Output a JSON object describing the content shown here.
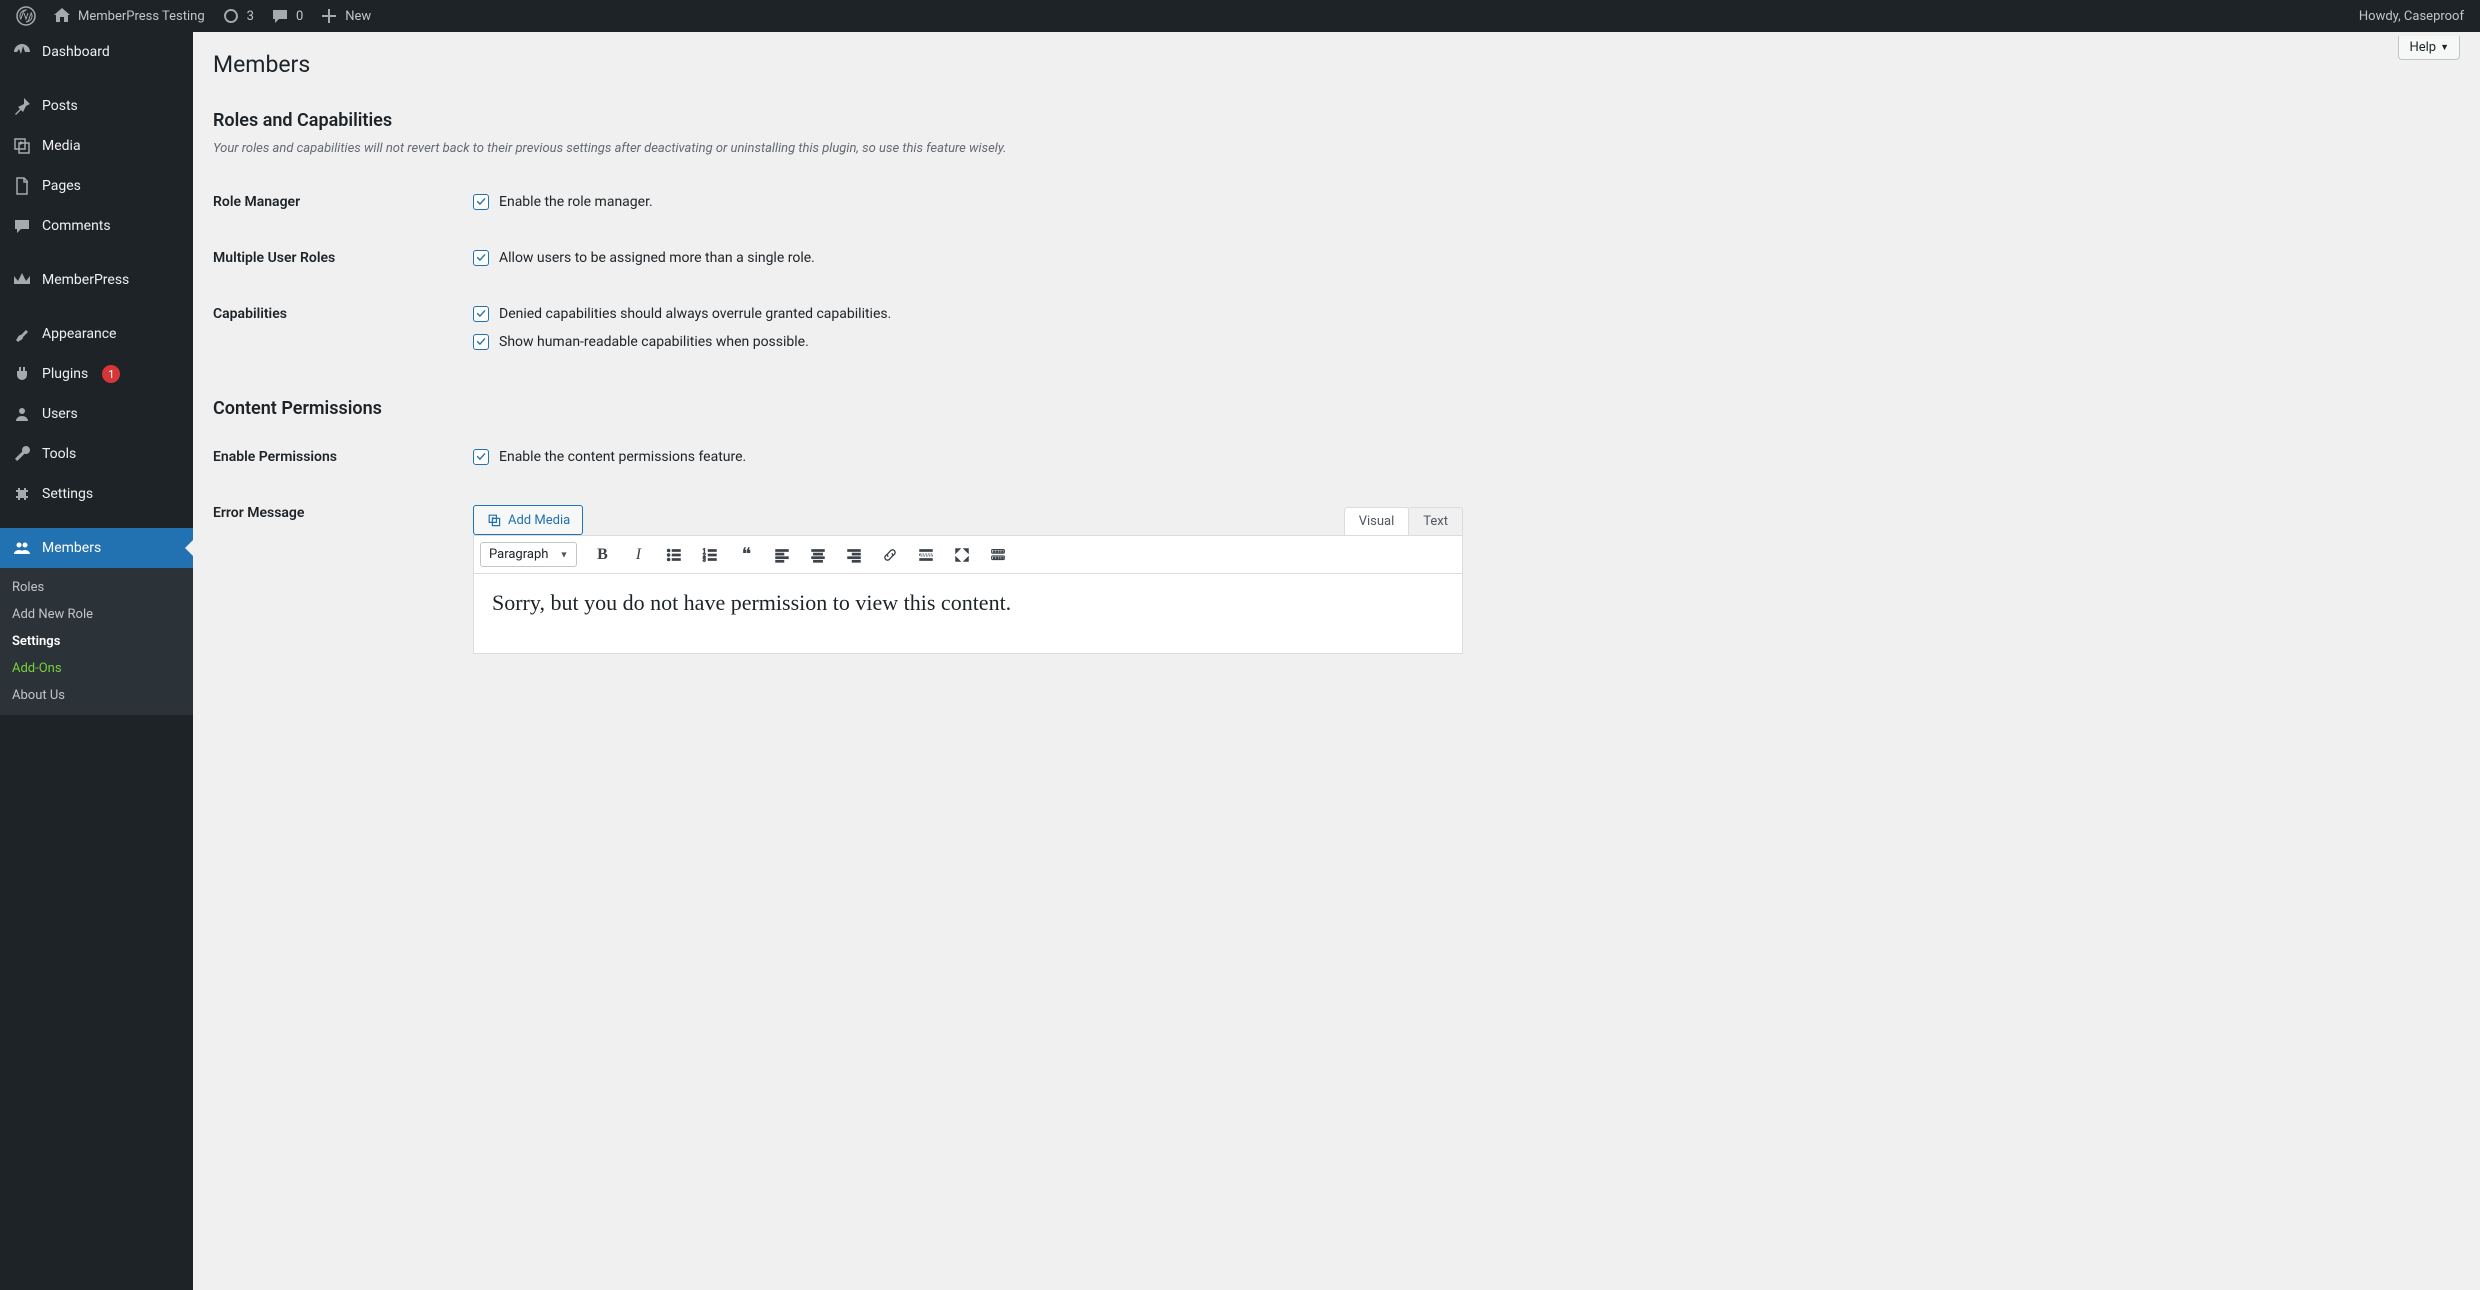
{
  "adminbar": {
    "site_name": "MemberPress Testing",
    "updates": "3",
    "comments": "0",
    "new": "New",
    "howdy": "Howdy, Caseproof"
  },
  "sidebar": {
    "items": [
      {
        "label": "Dashboard",
        "icon": "dashboard"
      },
      {
        "label": "Posts",
        "icon": "pin"
      },
      {
        "label": "Media",
        "icon": "media"
      },
      {
        "label": "Pages",
        "icon": "page"
      },
      {
        "label": "Comments",
        "icon": "comment"
      },
      {
        "label": "MemberPress",
        "icon": "memberpress"
      },
      {
        "label": "Appearance",
        "icon": "brush"
      },
      {
        "label": "Plugins",
        "icon": "plug",
        "badge": "1"
      },
      {
        "label": "Users",
        "icon": "user"
      },
      {
        "label": "Tools",
        "icon": "wrench"
      },
      {
        "label": "Settings",
        "icon": "settings"
      },
      {
        "label": "Members",
        "icon": "members",
        "current": true
      }
    ],
    "submenu": [
      {
        "label": "Roles"
      },
      {
        "label": "Add New Role"
      },
      {
        "label": "Settings",
        "current": true
      },
      {
        "label": "Add-Ons",
        "addons": true
      },
      {
        "label": "About Us"
      }
    ]
  },
  "content": {
    "help_label": "Help",
    "page_title": "Members",
    "section1": {
      "heading": "Roles and Capabilities",
      "description": "Your roles and capabilities will not revert back to their previous settings after deactivating or uninstalling this plugin, so use this feature wisely.",
      "rows": {
        "role_manager": {
          "th": "Role Manager",
          "cb_label": "Enable the role manager."
        },
        "multiple_roles": {
          "th": "Multiple User Roles",
          "cb_label": "Allow users to be assigned more than a single role."
        },
        "capabilities": {
          "th": "Capabilities",
          "cb1_label": "Denied capabilities should always overrule granted capabilities.",
          "cb2_label": "Show human-readable capabilities when possible."
        }
      }
    },
    "section2": {
      "heading": "Content Permissions",
      "rows": {
        "enable_permissions": {
          "th": "Enable Permissions",
          "cb_label": "Enable the content permissions feature."
        },
        "error_message": {
          "th": "Error Message"
        }
      }
    },
    "editor": {
      "add_media": "Add Media",
      "tab_visual": "Visual",
      "tab_text": "Text",
      "paragraph_label": "Paragraph",
      "content_text": "Sorry, but you do not have permission to view this content."
    }
  }
}
